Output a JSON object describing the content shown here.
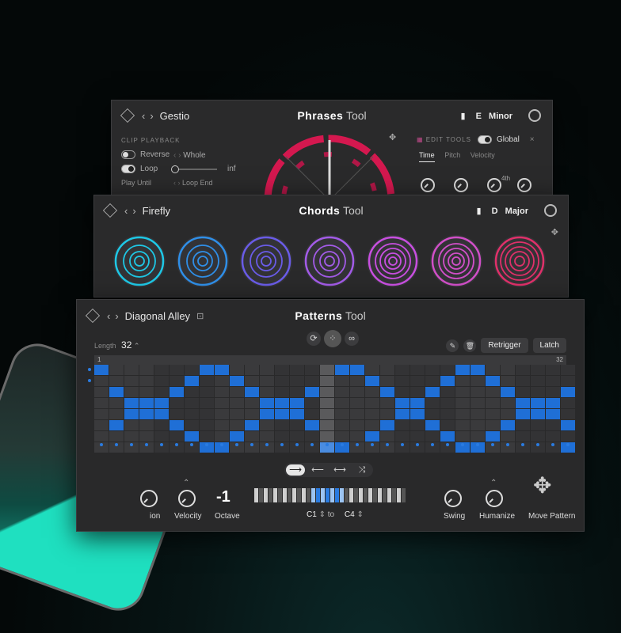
{
  "phrases": {
    "preset": "Gestio",
    "title_bold": "Phrases",
    "title_light": "Tool",
    "key_note": "E",
    "key_scale": "Minor",
    "clip_playback_label": "CLIP PLAYBACK",
    "reverse_label": "Reverse",
    "whole_label": "Whole",
    "loop_label": "Loop",
    "inf_label": "inf",
    "play_until_label": "Play Until",
    "loop_end_label": "Loop End",
    "edit_tools_label": "EDIT TOOLS",
    "global_label": "Global",
    "tabs": [
      "Time",
      "Pitch",
      "Velocity"
    ],
    "fourth_label": "4th"
  },
  "chords": {
    "preset": "Firefly",
    "title_bold": "Chords",
    "title_light": "Tool",
    "key_note": "D",
    "key_scale": "Major",
    "pads": [
      {
        "color": "#1ec8e6"
      },
      {
        "color": "#2f8fe8"
      },
      {
        "color": "#6a5ce8"
      },
      {
        "color": "#a35be8"
      },
      {
        "color": "#c84fe0"
      },
      {
        "color": "#d14fc8"
      },
      {
        "color": "#e0306a"
      }
    ]
  },
  "patterns": {
    "preset": "Diagonal Alley",
    "title_bold": "Patterns",
    "title_light": "Tool",
    "length_label": "Length",
    "length_value": "32",
    "retrigger_label": "Retrigger",
    "latch_label": "Latch",
    "step_start": "1",
    "step_end": "32",
    "grid_rows": [
      [
        1,
        0,
        0,
        0,
        0,
        0,
        0,
        1,
        1,
        0,
        0,
        0,
        0,
        0,
        0,
        0,
        1,
        1,
        0,
        0,
        0,
        0,
        0,
        0,
        1,
        1,
        0,
        0,
        0,
        0,
        0,
        0
      ],
      [
        0,
        0,
        0,
        0,
        0,
        0,
        1,
        0,
        0,
        1,
        0,
        0,
        0,
        0,
        0,
        0,
        0,
        0,
        1,
        0,
        0,
        0,
        0,
        1,
        0,
        0,
        1,
        0,
        0,
        0,
        0,
        0
      ],
      [
        0,
        1,
        0,
        0,
        0,
        1,
        0,
        0,
        0,
        0,
        1,
        0,
        0,
        0,
        1,
        0,
        0,
        0,
        0,
        1,
        0,
        0,
        1,
        0,
        0,
        0,
        0,
        1,
        0,
        0,
        0,
        1
      ],
      [
        0,
        0,
        1,
        1,
        1,
        0,
        0,
        0,
        0,
        0,
        0,
        1,
        1,
        1,
        0,
        0,
        0,
        0,
        0,
        0,
        1,
        1,
        0,
        0,
        0,
        0,
        0,
        0,
        1,
        1,
        1,
        0
      ],
      [
        0,
        0,
        1,
        1,
        1,
        0,
        0,
        0,
        0,
        0,
        0,
        1,
        1,
        1,
        0,
        0,
        0,
        0,
        0,
        0,
        1,
        1,
        0,
        0,
        0,
        0,
        0,
        0,
        1,
        1,
        1,
        0
      ],
      [
        0,
        1,
        0,
        0,
        0,
        1,
        0,
        0,
        0,
        0,
        1,
        0,
        0,
        0,
        1,
        0,
        0,
        0,
        0,
        1,
        0,
        0,
        1,
        0,
        0,
        0,
        0,
        1,
        0,
        0,
        0,
        1
      ],
      [
        0,
        0,
        0,
        0,
        0,
        0,
        1,
        0,
        0,
        1,
        0,
        0,
        0,
        0,
        0,
        0,
        0,
        0,
        1,
        0,
        0,
        0,
        0,
        1,
        0,
        0,
        1,
        0,
        0,
        0,
        0,
        0
      ],
      [
        0,
        0,
        0,
        0,
        0,
        0,
        0,
        1,
        1,
        0,
        0,
        0,
        0,
        0,
        0,
        1,
        1,
        0,
        0,
        0,
        0,
        0,
        0,
        0,
        1,
        1,
        0,
        0,
        0,
        0,
        0,
        1
      ]
    ],
    "playhead_step": 15,
    "direction_icons": [
      "arrow-right-icon",
      "arrow-left-icon",
      "arrow-both-icon",
      "shuffle-icon"
    ],
    "ion_label": "ion",
    "velocity_label": "Velocity",
    "octave_value": "-1",
    "octave_label": "Octave",
    "range_from": "C1",
    "range_to_label": "to",
    "range_to": "C4",
    "swing_label": "Swing",
    "humanize_label": "Humanize",
    "move_pattern_label": "Move Pattern"
  },
  "colors": {
    "accent_blue": "#1f6fd6",
    "phrase_red": "#d4184f"
  }
}
